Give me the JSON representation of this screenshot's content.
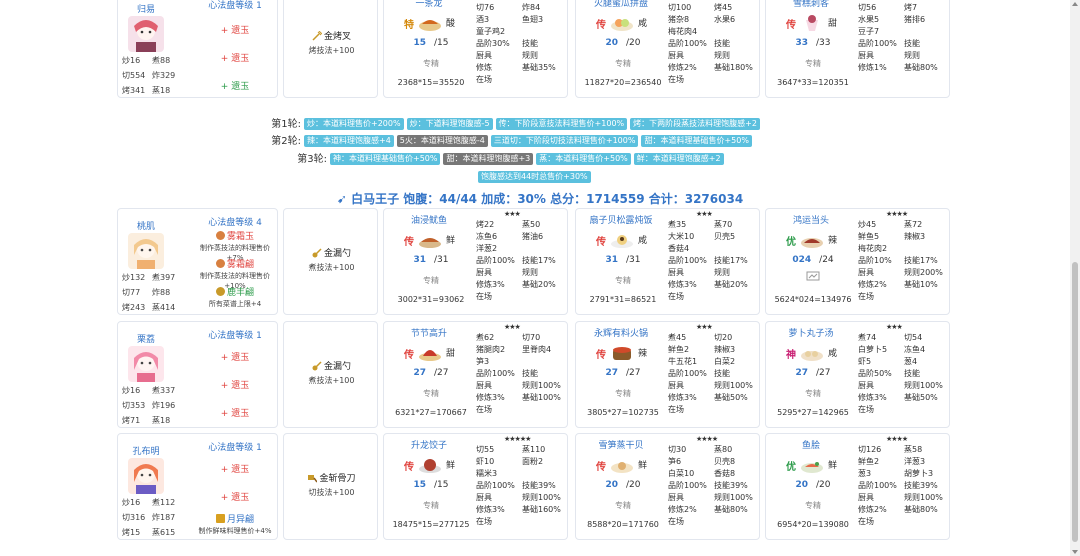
{
  "top_row": {
    "chef": {
      "name": "归易",
      "level": "心法盘等级 1",
      "stats": [
        "炒16",
        "煮88",
        "切554",
        "炸329",
        "烤341",
        "蒸18"
      ],
      "slots": [
        {
          "plus": "+",
          "name": "遗玉",
          "color": "red"
        },
        {
          "plus": "+",
          "name": "遗玉",
          "color": "red"
        },
        {
          "plus": "+",
          "name": "遗玉",
          "color": "green"
        }
      ]
    },
    "equip": {
      "name": "金烤叉",
      "desc": "烤技法+100"
    },
    "dishes": [
      {
        "name": "一条龙",
        "stars": "",
        "tag": "特",
        "flavor": "酸",
        "count": "15",
        "max": "/15",
        "spec": "专精",
        "calc": "2368*15=35520",
        "right": [
          [
            "切76",
            "炸84"
          ],
          [
            "酒3",
            "鱼翅3"
          ],
          [
            "童子鸡2",
            ""
          ],
          [
            "品阶30%",
            "技能"
          ],
          [
            "厨具",
            "规则"
          ],
          [
            "修炼",
            "基础35%"
          ],
          [
            "在场",
            ""
          ]
        ]
      },
      {
        "name": "火腿蜜瓜拼盘",
        "stars": "",
        "tag": "传",
        "flavor": "咸",
        "count": "20",
        "max": "/20",
        "spec": "专精",
        "calc": "11827*20=236540",
        "right": [
          [
            "切100",
            "烤45"
          ],
          [
            "猪杂8",
            "水果6"
          ],
          [
            "梅花肉4",
            ""
          ],
          [
            "品阶100%",
            "技能"
          ],
          [
            "厨具",
            "规则"
          ],
          [
            "修炼2%",
            "基础180%"
          ],
          [
            "在场",
            ""
          ]
        ]
      },
      {
        "name": "雪糕刺客",
        "stars": "",
        "tag": "传",
        "flavor": "甜",
        "count": "33",
        "max": "/33",
        "spec": "专精",
        "calc": "3647*33=120351",
        "right": [
          [
            "切56",
            "烤7"
          ],
          [
            "水果5",
            "猪排6"
          ],
          [
            "豆子7",
            ""
          ],
          [
            "品阶100%",
            "技能"
          ],
          [
            "厨具",
            "规则"
          ],
          [
            "修炼1%",
            "基础80%"
          ],
          [
            "",
            ""
          ]
        ]
      }
    ]
  },
  "rounds": [
    {
      "label": "第1轮:",
      "badges": [
        {
          "text": "炒：本道料理售价+200%",
          "gray": false
        },
        {
          "text": "炒：下道料理饱腹感-5",
          "gray": false
        },
        {
          "text": "传：下阶段意技法料理售价+100%",
          "gray": false
        },
        {
          "text": "烤：下两阶段蒸技法料理饱腹感+2",
          "gray": false
        }
      ]
    },
    {
      "label": "第2轮:",
      "badges": [
        {
          "text": "辣：本道料理饱腹感+4",
          "gray": false
        },
        {
          "text": "5火：本道料理饱腹感-4",
          "gray": true
        },
        {
          "text": "三道切：下阶段切技法料理售价+100%",
          "gray": false
        },
        {
          "text": "甜：本道料理基础售价+50%",
          "gray": false
        }
      ]
    },
    {
      "label": "第3轮:",
      "badges": [
        {
          "text": "神：本道料理基础售价+50%",
          "gray": false
        },
        {
          "text": "甜：本道料理饱腹感+3",
          "gray": true
        },
        {
          "text": "蒸：本道料理售价+50%",
          "gray": false
        },
        {
          "text": "鲜：本道料理饱腹感+2",
          "gray": false
        }
      ]
    },
    {
      "label": "",
      "badges": [
        {
          "text": "饱腹感达到44时总售价+30%",
          "gray": false
        }
      ]
    }
  ],
  "summary": "白马王子 饱腹：44/44 加成：30% 总分：1714559 合计：3276034",
  "rows": [
    {
      "chef": {
        "name": "桃肌",
        "level": "心法盘等级 4",
        "stats": [
          "炒132",
          "煮397",
          "切77",
          "炸88",
          "烤243",
          "蒸414"
        ],
        "slots": [
          {
            "plus": "",
            "name": "雾霜玉",
            "color": "red",
            "sub": "制作蒸技法的料理售价+7%"
          },
          {
            "plus": "",
            "name": "雾霜翩",
            "color": "red",
            "sub": "制作蒸技法的料理售价+10%"
          },
          {
            "plus": "",
            "name": "鹿丰翩",
            "color": "green",
            "sub": "所有菜谱上限+4"
          }
        ]
      },
      "equip": {
        "name": "金漏勺",
        "desc": "煮技法+100"
      },
      "dishes": [
        {
          "name": "油浸鱿鱼",
          "stars": "★★★",
          "tag": "传",
          "flavor": "鲜",
          "count": "31",
          "max": "/31",
          "spec": "专精",
          "calc": "3002*31=93062",
          "right": [
            [
              "烤22",
              "蒸50"
            ],
            [
              "冻鱼6",
              "猪油6"
            ],
            [
              "洋葱2",
              ""
            ],
            [
              "品阶100%",
              "技能17%"
            ],
            [
              "厨具",
              "规则"
            ],
            [
              "修炼3%",
              "基础20%"
            ],
            [
              "在场",
              ""
            ]
          ]
        },
        {
          "name": "扇子贝松露炖饭",
          "stars": "★★★",
          "tag": "传",
          "flavor": "咸",
          "count": "31",
          "max": "/31",
          "spec": "专精",
          "calc": "2791*31=86521",
          "right": [
            [
              "煮35",
              "蒸70"
            ],
            [
              "大米10",
              "贝壳5"
            ],
            [
              "香菇4",
              ""
            ],
            [
              "品阶100%",
              "技能17%"
            ],
            [
              "厨具",
              "规则"
            ],
            [
              "修炼3%",
              "基础20%"
            ],
            [
              "在场",
              ""
            ]
          ]
        },
        {
          "name": "鸿运当头",
          "stars": "★★★★",
          "tag": "优",
          "flavor": "辣",
          "count": "024",
          "max": "/24",
          "spec": "专精",
          "calc": "5624*024=134976",
          "right": [
            [
              "炒45",
              "蒸72"
            ],
            [
              "鲜鱼5",
              "辣椒3"
            ],
            [
              "梅花肉2",
              ""
            ],
            [
              "品阶10%",
              "技能17%"
            ],
            [
              "厨具",
              "规则200%"
            ],
            [
              "修炼2%",
              "基础10%"
            ],
            [
              "在场",
              ""
            ]
          ]
        }
      ]
    },
    {
      "chef": {
        "name": "栗荔",
        "level": "心法盘等级 1",
        "stats": [
          "炒16",
          "煮337",
          "切353",
          "炸196",
          "烤71",
          "蒸18"
        ],
        "slots": [
          {
            "plus": "+",
            "name": "遗玉",
            "color": "red"
          },
          {
            "plus": "+",
            "name": "遗玉",
            "color": "red"
          },
          {
            "plus": "+",
            "name": "遗玉",
            "color": "red"
          }
        ]
      },
      "equip": {
        "name": "金漏勺",
        "desc": "煮技法+100"
      },
      "dishes": [
        {
          "name": "节节高升",
          "stars": "★★★",
          "tag": "传",
          "flavor": "甜",
          "count": "27",
          "max": "/27",
          "spec": "专精",
          "calc": "6321*27=170667",
          "right": [
            [
              "煮62",
              "切70"
            ],
            [
              "猪腿肉2",
              "里脊肉4"
            ],
            [
              "笋3",
              ""
            ],
            [
              "品阶100%",
              "技能"
            ],
            [
              "厨具",
              "规则100%"
            ],
            [
              "修炼3%",
              "基础100%"
            ],
            [
              "在场",
              ""
            ]
          ]
        },
        {
          "name": "永辉有料火锅",
          "stars": "★★★",
          "tag": "传",
          "flavor": "辣",
          "count": "27",
          "max": "/27",
          "spec": "专精",
          "calc": "3805*27=102735",
          "right": [
            [
              "煮45",
              "切20"
            ],
            [
              "鲜鱼2",
              "辣椒3"
            ],
            [
              "牛五花1",
              "白菜2"
            ],
            [
              "品阶100%",
              "技能"
            ],
            [
              "厨具",
              "规则100%"
            ],
            [
              "修炼3%",
              "基础50%"
            ],
            [
              "在场",
              ""
            ]
          ]
        },
        {
          "name": "萝卜丸子汤",
          "stars": "★★★",
          "tag": "神",
          "flavor": "咸",
          "count": "27",
          "max": "/27",
          "spec": "专精",
          "calc": "5295*27=142965",
          "right": [
            [
              "煮74",
              "切54"
            ],
            [
              "白萝卜5",
              "冻鱼4"
            ],
            [
              "虾5",
              "葱4"
            ],
            [
              "品阶50%",
              "技能"
            ],
            [
              "厨具",
              "规则100%"
            ],
            [
              "修炼3%",
              "基础50%"
            ],
            [
              "在场",
              ""
            ]
          ]
        }
      ]
    },
    {
      "chef": {
        "name": "孔布明",
        "level": "心法盘等级 1",
        "stats": [
          "炒16",
          "煮112",
          "切316",
          "炸187",
          "烤15",
          "蒸615"
        ],
        "slots": [
          {
            "plus": "+",
            "name": "遗玉",
            "color": "red"
          },
          {
            "plus": "+",
            "name": "遗玉",
            "color": "red"
          },
          {
            "plus": "",
            "name": "月异翩",
            "color": "blue",
            "sub": "制作鲜味料理售价+4%"
          }
        ]
      },
      "equip": {
        "name": "金斩骨刀",
        "desc": "切技法+100"
      },
      "dishes": [
        {
          "name": "升龙饺子",
          "stars": "★★★★★",
          "tag": "传",
          "flavor": "鲜",
          "count": "15",
          "max": "/15",
          "spec": "专精",
          "calc": "18475*15=277125",
          "right": [
            [
              "切55",
              "蒸110"
            ],
            [
              "虾10",
              "面粉2"
            ],
            [
              "糯米3",
              ""
            ],
            [
              "品阶100%",
              "技能39%"
            ],
            [
              "厨具",
              "规则100%"
            ],
            [
              "修炼3%",
              "基础160%"
            ],
            [
              "在场",
              ""
            ]
          ]
        },
        {
          "name": "雪笋蒸干贝",
          "stars": "★★★★",
          "tag": "传",
          "flavor": "鲜",
          "count": "20",
          "max": "/20",
          "spec": "专精",
          "calc": "8588*20=171760",
          "right": [
            [
              "切30",
              "蒸80"
            ],
            [
              "笋6",
              "贝壳8"
            ],
            [
              "白菜10",
              "香菇8"
            ],
            [
              "品阶100%",
              "技能39%"
            ],
            [
              "厨具",
              "规则100%"
            ],
            [
              "修炼2%",
              "基础80%"
            ],
            [
              "在场",
              ""
            ]
          ]
        },
        {
          "name": "鱼脍",
          "stars": "★★★★",
          "tag": "优",
          "flavor": "鲜",
          "count": "20",
          "max": "/20",
          "spec": "专精",
          "calc": "6954*20=139080",
          "right": [
            [
              "切126",
              "蒸58"
            ],
            [
              "鲜鱼2",
              "洋葱3"
            ],
            [
              "葱3",
              "胡萝卜3"
            ],
            [
              "品阶100%",
              "技能39%"
            ],
            [
              "厨具",
              "规则100%"
            ],
            [
              "修炼2%",
              "基础80%"
            ],
            [
              "在场",
              ""
            ]
          ]
        }
      ]
    }
  ],
  "colors": {
    "accent": "#3474c6",
    "badge": "#5bc0de",
    "badge_dark": "#777777",
    "red": "#e0443f",
    "green": "#2c9b4a",
    "tag_chuan": "#e0443f",
    "tag_te": "#d4890c",
    "tag_you": "#2c9b4a",
    "tag_shen": "#c81e72"
  }
}
